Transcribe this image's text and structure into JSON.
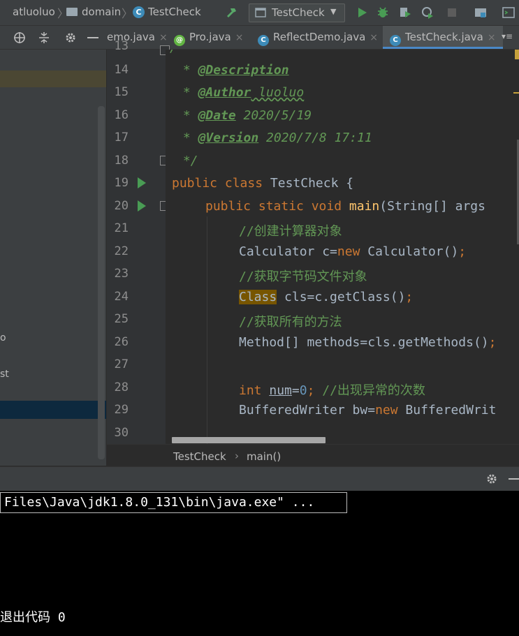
{
  "navbar": {
    "crumbs": [
      "atluoluo",
      "domain",
      "TestCheck"
    ],
    "run_config": "TestCheck"
  },
  "tabs": [
    {
      "label": "emo.java",
      "icon": "java-class-icon"
    },
    {
      "label": "Pro.java",
      "icon": "annotation-icon"
    },
    {
      "label": "ReflectDemo.java",
      "icon": "java-class-icon"
    },
    {
      "label": "TestCheck.java",
      "icon": "java-class-icon",
      "active": true
    }
  ],
  "left_panel": {
    "fragments": [
      "o",
      "st"
    ]
  },
  "line_numbers": [
    "13",
    "14",
    "15",
    "16",
    "17",
    "18",
    "19",
    "20",
    "21",
    "22",
    "23",
    "24",
    "25",
    "26",
    "27",
    "28",
    "29",
    "30"
  ],
  "code": {
    "l13": "/",
    "l14_star": " * ",
    "l14_tag": "@Description",
    "l15_star": " * ",
    "l15_tag": "@Author",
    "l15_val": " luoluo",
    "l16_star": " * ",
    "l16_tag": "@Date",
    "l16_val": " 2020/5/19",
    "l17_star": " * ",
    "l17_tag": "@Version",
    "l17_val": " 2020/7/8 17:11",
    "l18": " */",
    "l19_kw": "public class ",
    "l19_rest": "TestCheck {",
    "l20_kw": "public static void ",
    "l20_fn": "main",
    "l20_rest": "(String[] args",
    "l21": "//创建计算器对象",
    "l22_a": "Calculator c=",
    "l22_kw": "new",
    "l22_b": " Calculator()",
    "l22_semi": ";",
    "l23": "//获取字节码文件对象",
    "l24_hl": "Class",
    "l24_rest": " cls=c.getClass()",
    "l24_semi": ";",
    "l25": "//获取所有的方法",
    "l26": "Method[] methods=cls.getMethods()",
    "l26_semi": ";",
    "l28_kw": "int",
    "l28_var": "num",
    "l28_eq": "=",
    "l28_num": "0",
    "l28_semi": ";",
    "l28_cmt": " //出现异常的次数",
    "l29_a": "BufferedWriter bw=",
    "l29_kw": "new",
    "l29_b": " BufferedWrit"
  },
  "breadcrumb": {
    "class": "TestCheck",
    "sep": "›",
    "method": "main()"
  },
  "console": {
    "cmd": "Files\\Java\\jdk1.8.0_131\\bin\\java.exe\" ...",
    "exit": "退出代码 0"
  },
  "colors": {
    "keyword": "#cc7832",
    "doc": "#629755",
    "method": "#ffc66d",
    "number": "#6897bb",
    "text": "#a9b7c6",
    "run_green": "#499c54",
    "accent_blue": "#4a88c7"
  }
}
